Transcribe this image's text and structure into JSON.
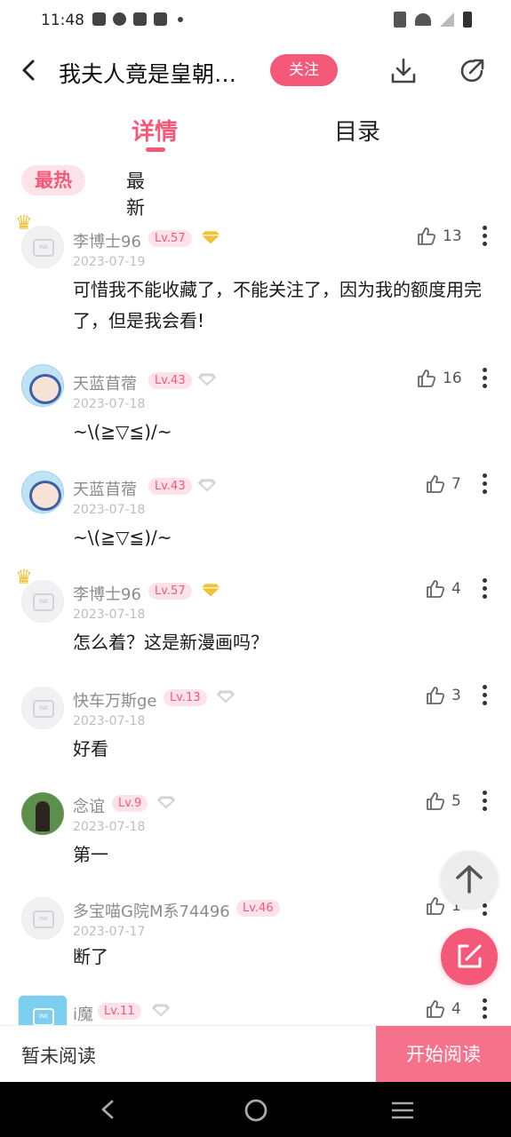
{
  "status_bar": {
    "time": "11:48"
  },
  "header": {
    "title": "我夫人竟是皇朝…",
    "follow_label": "关注"
  },
  "tabs": [
    {
      "label": "详情",
      "active": true
    },
    {
      "label": "目录",
      "active": false
    }
  ],
  "sort": {
    "hot_label": "最热",
    "new_label": "最新"
  },
  "comments": [
    {
      "username": "李博士96",
      "level": "Lv.57",
      "date": "2023-07-19",
      "text": "可惜我不能收藏了，不能关注了，因为我的额度用完了，但是我会看!",
      "likes": "13",
      "diamond": "gold",
      "avatar": "default-crown"
    },
    {
      "username": "天蓝苜蓿",
      "level": "Lv.43",
      "date": "2023-07-18",
      "text": "~\\(≧▽≦)/~",
      "likes": "16",
      "diamond": "gray",
      "avatar": "anime"
    },
    {
      "username": "天蓝苜蓿",
      "level": "Lv.43",
      "date": "2023-07-18",
      "text": "~\\(≧▽≦)/~",
      "likes": "7",
      "diamond": "gray",
      "avatar": "anime"
    },
    {
      "username": "李博士96",
      "level": "Lv.57",
      "date": "2023-07-18",
      "text": "怎么着？这是新漫画吗？",
      "likes": "4",
      "diamond": "gold",
      "avatar": "default-crown"
    },
    {
      "username": "快车万斯ge",
      "level": "Lv.13",
      "date": "2023-07-18",
      "text": "好看",
      "likes": "3",
      "diamond": "gray",
      "avatar": "default"
    },
    {
      "username": "念谊",
      "level": "Lv.9",
      "date": "2023-07-18",
      "text": "第一",
      "likes": "5",
      "diamond": "gray",
      "avatar": "photo"
    },
    {
      "username": "多宝喵G院M系74496",
      "level": "Lv.46",
      "date": "2023-07-17",
      "text": "断了",
      "likes": "1",
      "diamond": "none",
      "avatar": "default"
    },
    {
      "username": "i魔",
      "level": "Lv.11",
      "date": "",
      "text": "",
      "likes": "4",
      "diamond": "gray",
      "avatar": "cat"
    }
  ],
  "bottom_bar": {
    "unread_label": "暂未阅读",
    "start_label": "开始阅读"
  },
  "colors": {
    "accent": "#f5597a",
    "gold": "#f1c232",
    "gray": "#c8c8c8"
  }
}
